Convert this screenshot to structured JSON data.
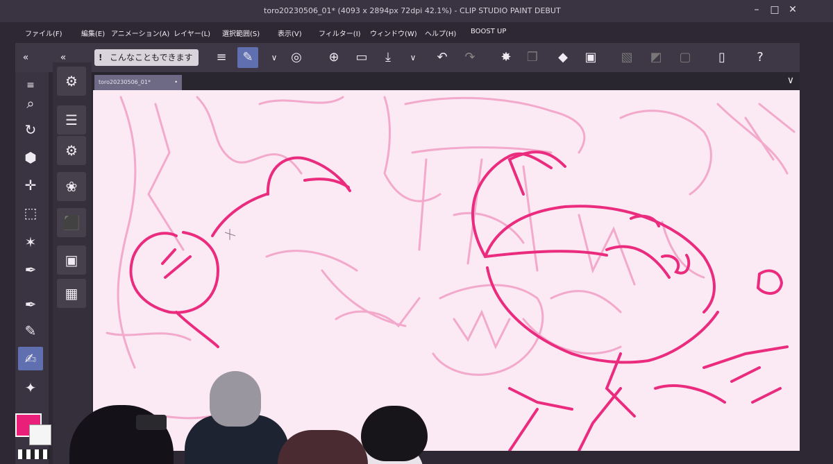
{
  "window": {
    "title": "toro20230506_01* (4093 x 2894px 72dpi 42.1%) - CLIP STUDIO PAINT DEBUT"
  },
  "menu": [
    {
      "label": "ファイル(F)"
    },
    {
      "label": "編集(E)"
    },
    {
      "label": "アニメーション(A)"
    },
    {
      "label": "レイヤー(L)"
    },
    {
      "label": "選択範囲(S)"
    },
    {
      "label": "表示(V)"
    },
    {
      "label": "フィルター(I)"
    },
    {
      "label": "ウィンドウ(W)"
    },
    {
      "label": "ヘルプ(H)"
    },
    {
      "label": "BOOST UP"
    }
  ],
  "toolbar": {
    "tips_label": "こんなこともできます",
    "tips_icon": "!",
    "collapse_left": "«",
    "collapse_right": "«"
  },
  "document": {
    "tab_label": "toro20230506_01*"
  },
  "colors": {
    "main": "#ea1f7a",
    "sub": "#f5f5f5",
    "canvas": "#fbe9f3",
    "stroke_bold": "#ea2b7e",
    "stroke_light": "#f2a9cb"
  }
}
